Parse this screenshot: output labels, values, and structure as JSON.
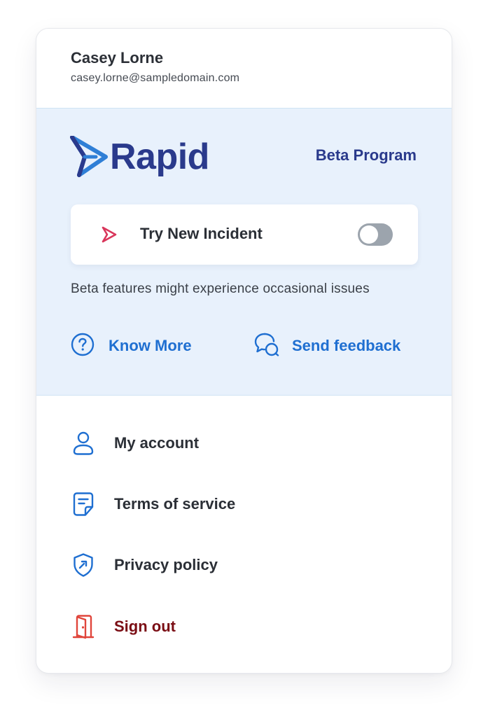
{
  "user": {
    "name": "Casey Lorne",
    "email": "casey.lorne@sampledomain.com"
  },
  "beta": {
    "brand": "Rapid",
    "program_label": "Beta Program",
    "toggle": {
      "label": "Try New Incident",
      "enabled": false
    },
    "note": "Beta features might experience occasional issues",
    "links": {
      "know_more": "Know More",
      "send_feedback": "Send feedback"
    }
  },
  "menu": {
    "items": [
      {
        "label": "My account",
        "icon": "user-icon"
      },
      {
        "label": "Terms of service",
        "icon": "document-icon"
      },
      {
        "label": "Privacy policy",
        "icon": "shield-icon"
      },
      {
        "label": "Sign out",
        "icon": "door-exit-icon"
      }
    ]
  },
  "colors": {
    "brand_navy": "#2a3a8c",
    "brand_blue": "#2f7fd6",
    "link_blue": "#1f6fd1",
    "beta_bg": "#e8f1fc",
    "sign_out": "#7a0d14",
    "sign_out_icon": "#e0453b",
    "toggle_icon": "#d9365b"
  }
}
